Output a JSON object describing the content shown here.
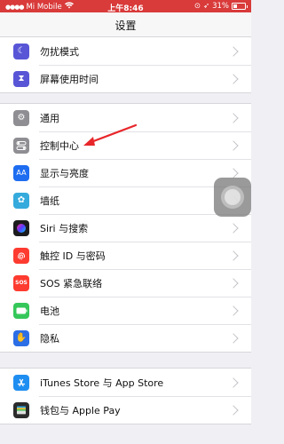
{
  "status_bar": {
    "carrier": "Mi Mobile",
    "time": "上午8:46",
    "battery": "31%",
    "battery_level": 0.31
  },
  "nav": {
    "title": "设置"
  },
  "groups": [
    {
      "items": [
        {
          "label": "勿扰模式",
          "icon": "moon-icon",
          "color": "#5856d6"
        },
        {
          "label": "屏幕使用时间",
          "icon": "hourglass-icon",
          "color": "#5856d6"
        }
      ]
    },
    {
      "items": [
        {
          "label": "通用",
          "icon": "gear-icon",
          "color": "#8e8e93"
        },
        {
          "label": "控制中心",
          "icon": "toggle-icon",
          "color": "#8e8e93"
        },
        {
          "label": "显示与亮度",
          "icon": "aa-icon",
          "color": "#1e6df1"
        },
        {
          "label": "墙纸",
          "icon": "flower-icon",
          "color": "#35aadc"
        },
        {
          "label": "Siri 与搜索",
          "icon": "siri-icon",
          "color": "#1c1c1e"
        },
        {
          "label": "触控 ID 与密码",
          "icon": "fingerprint-icon",
          "color": "#fe3b30"
        },
        {
          "label": "SOS 紧急联络",
          "icon": "sos-icon",
          "color": "#fe3b30",
          "glyph": "SOS"
        },
        {
          "label": "电池",
          "icon": "battery-icon",
          "color": "#35c759"
        },
        {
          "label": "隐私",
          "icon": "hand-icon",
          "color": "#2c6ee6"
        }
      ]
    },
    {
      "items": [
        {
          "label": "iTunes Store 与 App Store",
          "icon": "app-store-icon",
          "color": "#1f8ef1"
        },
        {
          "label": "钱包与 Apple Pay",
          "icon": "wallet-icon",
          "color": "#2b2b2b"
        }
      ]
    }
  ]
}
